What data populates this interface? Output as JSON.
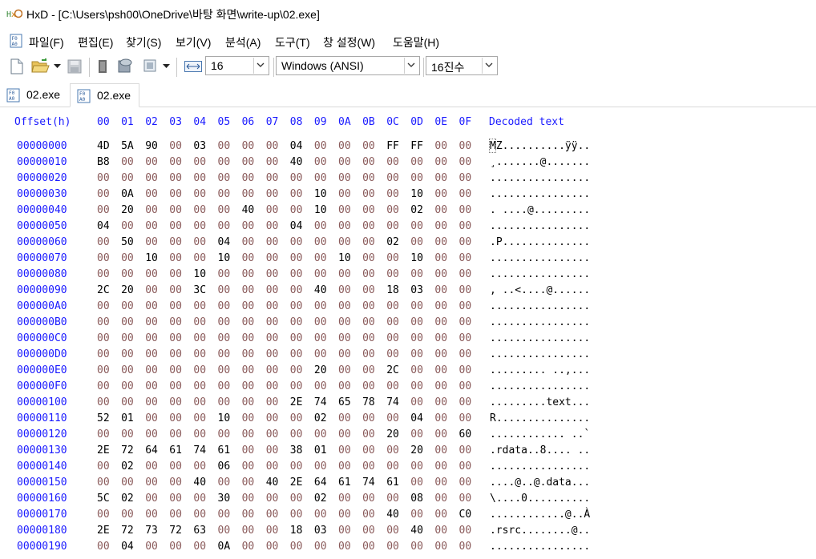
{
  "window": {
    "title": "HxD - [C:\\Users\\psh00\\OneDrive\\바탕 화면\\write-up\\02.exe]",
    "icon": "hxd-app-icon"
  },
  "menu": {
    "items": [
      "파일(F)",
      "편집(E)",
      "찾기(S)",
      "보기(V)",
      "분석(A)",
      "도구(T)",
      "창 설정(W)",
      "도움말(H)"
    ]
  },
  "toolbar": {
    "bytes_per_row": "16",
    "encoding": "Windows (ANSI)",
    "offset_base": "16진수"
  },
  "tabs": [
    {
      "label": "02.exe",
      "active": false
    },
    {
      "label": "02.exe",
      "active": true
    }
  ],
  "hex": {
    "offset_header": "Offset(h)",
    "column_headers": [
      "00",
      "01",
      "02",
      "03",
      "04",
      "05",
      "06",
      "07",
      "08",
      "09",
      "0A",
      "0B",
      "0C",
      "0D",
      "0E",
      "0F"
    ],
    "decoded_header": "Decoded text",
    "rows": [
      {
        "offset": "00000000",
        "bytes": [
          "4D",
          "5A",
          "90",
          "00",
          "03",
          "00",
          "00",
          "00",
          "04",
          "00",
          "00",
          "00",
          "FF",
          "FF",
          "00",
          "00"
        ],
        "text": "MZ..........ÿÿ.."
      },
      {
        "offset": "00000010",
        "bytes": [
          "B8",
          "00",
          "00",
          "00",
          "00",
          "00",
          "00",
          "00",
          "40",
          "00",
          "00",
          "00",
          "00",
          "00",
          "00",
          "00"
        ],
        "text": "¸.......@......."
      },
      {
        "offset": "00000020",
        "bytes": [
          "00",
          "00",
          "00",
          "00",
          "00",
          "00",
          "00",
          "00",
          "00",
          "00",
          "00",
          "00",
          "00",
          "00",
          "00",
          "00"
        ],
        "text": "................"
      },
      {
        "offset": "00000030",
        "bytes": [
          "00",
          "0A",
          "00",
          "00",
          "00",
          "00",
          "00",
          "00",
          "00",
          "10",
          "00",
          "00",
          "00",
          "10",
          "00",
          "00"
        ],
        "text": "................"
      },
      {
        "offset": "00000040",
        "bytes": [
          "00",
          "20",
          "00",
          "00",
          "00",
          "00",
          "40",
          "00",
          "00",
          "10",
          "00",
          "00",
          "00",
          "02",
          "00",
          "00"
        ],
        "text": ". ....@........."
      },
      {
        "offset": "00000050",
        "bytes": [
          "04",
          "00",
          "00",
          "00",
          "00",
          "00",
          "00",
          "00",
          "04",
          "00",
          "00",
          "00",
          "00",
          "00",
          "00",
          "00"
        ],
        "text": "................"
      },
      {
        "offset": "00000060",
        "bytes": [
          "00",
          "50",
          "00",
          "00",
          "00",
          "04",
          "00",
          "00",
          "00",
          "00",
          "00",
          "00",
          "02",
          "00",
          "00",
          "00"
        ],
        "text": ".P.............."
      },
      {
        "offset": "00000070",
        "bytes": [
          "00",
          "00",
          "10",
          "00",
          "00",
          "10",
          "00",
          "00",
          "00",
          "00",
          "10",
          "00",
          "00",
          "10",
          "00",
          "00"
        ],
        "text": "................"
      },
      {
        "offset": "00000080",
        "bytes": [
          "00",
          "00",
          "00",
          "00",
          "10",
          "00",
          "00",
          "00",
          "00",
          "00",
          "00",
          "00",
          "00",
          "00",
          "00",
          "00"
        ],
        "text": "................"
      },
      {
        "offset": "00000090",
        "bytes": [
          "2C",
          "20",
          "00",
          "00",
          "3C",
          "00",
          "00",
          "00",
          "00",
          "40",
          "00",
          "00",
          "18",
          "03",
          "00",
          "00"
        ],
        "text": ", ..<....@......"
      },
      {
        "offset": "000000A0",
        "bytes": [
          "00",
          "00",
          "00",
          "00",
          "00",
          "00",
          "00",
          "00",
          "00",
          "00",
          "00",
          "00",
          "00",
          "00",
          "00",
          "00"
        ],
        "text": "................"
      },
      {
        "offset": "000000B0",
        "bytes": [
          "00",
          "00",
          "00",
          "00",
          "00",
          "00",
          "00",
          "00",
          "00",
          "00",
          "00",
          "00",
          "00",
          "00",
          "00",
          "00"
        ],
        "text": "................"
      },
      {
        "offset": "000000C0",
        "bytes": [
          "00",
          "00",
          "00",
          "00",
          "00",
          "00",
          "00",
          "00",
          "00",
          "00",
          "00",
          "00",
          "00",
          "00",
          "00",
          "00"
        ],
        "text": "................"
      },
      {
        "offset": "000000D0",
        "bytes": [
          "00",
          "00",
          "00",
          "00",
          "00",
          "00",
          "00",
          "00",
          "00",
          "00",
          "00",
          "00",
          "00",
          "00",
          "00",
          "00"
        ],
        "text": "................"
      },
      {
        "offset": "000000E0",
        "bytes": [
          "00",
          "00",
          "00",
          "00",
          "00",
          "00",
          "00",
          "00",
          "00",
          "20",
          "00",
          "00",
          "2C",
          "00",
          "00",
          "00"
        ],
        "text": "......... ..,..."
      },
      {
        "offset": "000000F0",
        "bytes": [
          "00",
          "00",
          "00",
          "00",
          "00",
          "00",
          "00",
          "00",
          "00",
          "00",
          "00",
          "00",
          "00",
          "00",
          "00",
          "00"
        ],
        "text": "................"
      },
      {
        "offset": "00000100",
        "bytes": [
          "00",
          "00",
          "00",
          "00",
          "00",
          "00",
          "00",
          "00",
          "2E",
          "74",
          "65",
          "78",
          "74",
          "00",
          "00",
          "00"
        ],
        "text": ".........text..."
      },
      {
        "offset": "00000110",
        "bytes": [
          "52",
          "01",
          "00",
          "00",
          "00",
          "10",
          "00",
          "00",
          "00",
          "02",
          "00",
          "00",
          "00",
          "04",
          "00",
          "00"
        ],
        "text": "R..............."
      },
      {
        "offset": "00000120",
        "bytes": [
          "00",
          "00",
          "00",
          "00",
          "00",
          "00",
          "00",
          "00",
          "00",
          "00",
          "00",
          "00",
          "20",
          "00",
          "00",
          "60"
        ],
        "text": "............ ..`"
      },
      {
        "offset": "00000130",
        "bytes": [
          "2E",
          "72",
          "64",
          "61",
          "74",
          "61",
          "00",
          "00",
          "38",
          "01",
          "00",
          "00",
          "00",
          "20",
          "00",
          "00"
        ],
        "text": ".rdata..8.... .."
      },
      {
        "offset": "00000140",
        "bytes": [
          "00",
          "02",
          "00",
          "00",
          "00",
          "06",
          "00",
          "00",
          "00",
          "00",
          "00",
          "00",
          "00",
          "00",
          "00",
          "00"
        ],
        "text": "................"
      },
      {
        "offset": "00000150",
        "bytes": [
          "00",
          "00",
          "00",
          "00",
          "40",
          "00",
          "00",
          "40",
          "2E",
          "64",
          "61",
          "74",
          "61",
          "00",
          "00",
          "00"
        ],
        "text": "....@..@.data..."
      },
      {
        "offset": "00000160",
        "bytes": [
          "5C",
          "02",
          "00",
          "00",
          "00",
          "30",
          "00",
          "00",
          "00",
          "02",
          "00",
          "00",
          "00",
          "08",
          "00",
          "00"
        ],
        "text": "\\....0.........."
      },
      {
        "offset": "00000170",
        "bytes": [
          "00",
          "00",
          "00",
          "00",
          "00",
          "00",
          "00",
          "00",
          "00",
          "00",
          "00",
          "00",
          "40",
          "00",
          "00",
          "C0"
        ],
        "text": "............@..À"
      },
      {
        "offset": "00000180",
        "bytes": [
          "2E",
          "72",
          "73",
          "72",
          "63",
          "00",
          "00",
          "00",
          "18",
          "03",
          "00",
          "00",
          "00",
          "40",
          "00",
          "00"
        ],
        "text": ".rsrc........@.."
      },
      {
        "offset": "00000190",
        "bytes": [
          "00",
          "04",
          "00",
          "00",
          "00",
          "0A",
          "00",
          "00",
          "00",
          "00",
          "00",
          "00",
          "00",
          "00",
          "00",
          "00"
        ],
        "text": "................"
      }
    ]
  }
}
